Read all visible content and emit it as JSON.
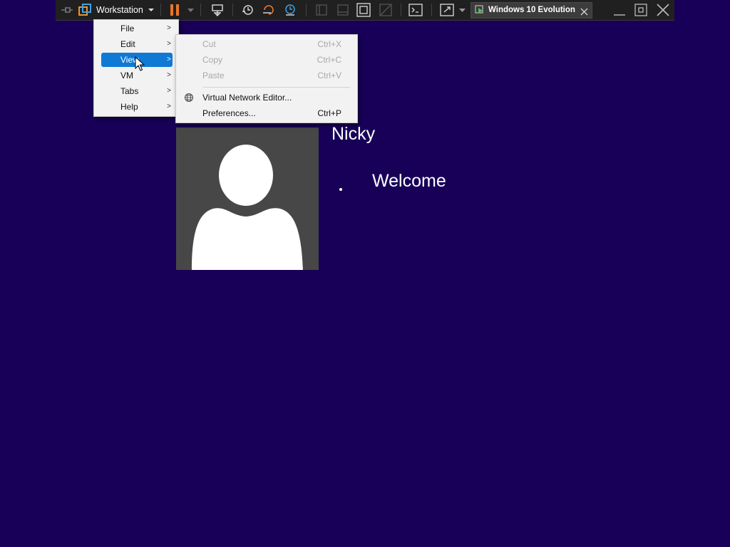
{
  "app": {
    "name": "Workstation"
  },
  "toolbar": {
    "icons": [
      "pin-icon",
      "workstation-logo-icon",
      "dropdown-icon",
      "pause-icon",
      "send-keys-icon",
      "snapshot-icon",
      "revert-snapshot-icon",
      "snapshot-manager-icon",
      "library-view-icon",
      "thumbnail-view-icon",
      "fit-guest-icon",
      "unity-icon",
      "console-icon",
      "fullscreen-icon"
    ],
    "vm_tab": {
      "title": "Windows 10 Evolution"
    }
  },
  "main_menu": {
    "items": [
      {
        "label": "File",
        "has_submenu": true
      },
      {
        "label": "Edit",
        "has_submenu": true
      },
      {
        "label": "View",
        "has_submenu": true,
        "active": true
      },
      {
        "label": "VM",
        "has_submenu": true
      },
      {
        "label": "Tabs",
        "has_submenu": true
      },
      {
        "label": "Help",
        "has_submenu": true
      }
    ]
  },
  "edit_submenu": {
    "items": [
      {
        "label": "Cut",
        "shortcut": "Ctrl+X",
        "enabled": false
      },
      {
        "label": "Copy",
        "shortcut": "Ctrl+C",
        "enabled": false
      },
      {
        "label": "Paste",
        "shortcut": "Ctrl+V",
        "enabled": false
      },
      {
        "label": "Virtual Network Editor...",
        "shortcut": "",
        "enabled": true,
        "icon": "network-globe-icon"
      },
      {
        "label": "Preferences...",
        "shortcut": "Ctrl+P",
        "enabled": true
      }
    ]
  },
  "guest_screen": {
    "username": "Nicky",
    "status": "Welcome",
    "background_color": "#180058"
  },
  "colors": {
    "accent": "#0f7ad6",
    "pause": "#e8762c",
    "toolbar_bg": "#202020"
  }
}
